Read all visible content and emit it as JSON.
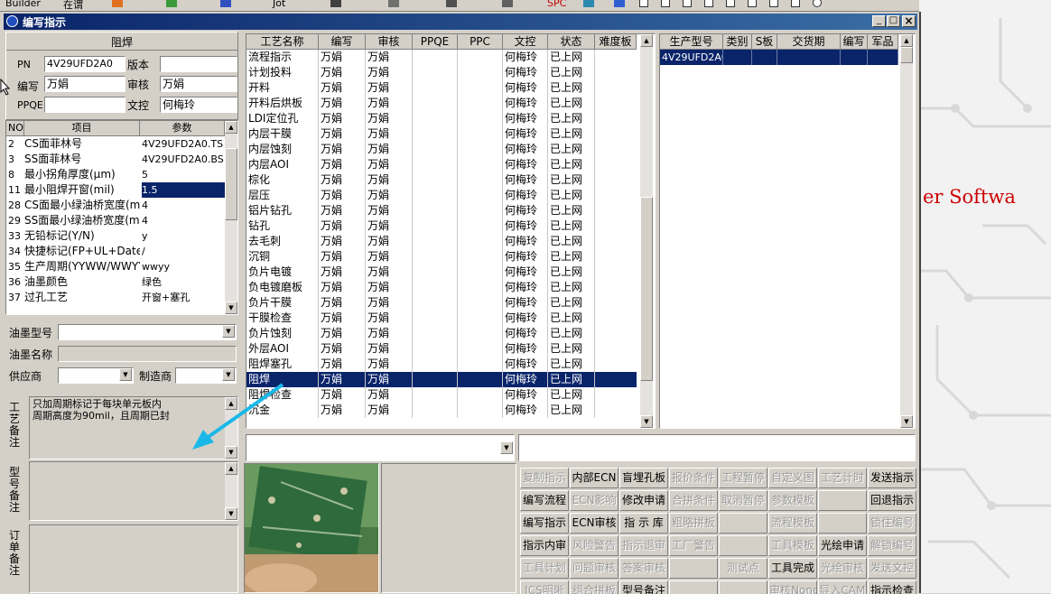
{
  "taskbar": {
    "app_label": "Builder",
    "item2": "在谓",
    "item3": "Jot",
    "item4": "SPC"
  },
  "background_text": "er Softwa",
  "window": {
    "title": "编写指示",
    "minimize": "_",
    "maximize": "□",
    "close": "×"
  },
  "header": {
    "section": "阻焊",
    "pn_label": "PN",
    "pn_value": "4V29UFD2A0",
    "version_label": "版本",
    "version_value": "",
    "writer_label": "编写",
    "writer_value": "万娟",
    "reviewer_label": "审核",
    "reviewer_value": "万娟",
    "ppqe_label": "PPQE",
    "ppqe_value": "",
    "doc_label": "文控",
    "doc_value": "何梅玲"
  },
  "params": {
    "col_no": "NO",
    "col_item": "项目",
    "col_param": "参数",
    "rows": [
      {
        "no": "2",
        "item": "CS面菲林号",
        "param": "4V29UFD2A0.TS"
      },
      {
        "no": "3",
        "item": "SS面菲林号",
        "param": "4V29UFD2A0.BS"
      },
      {
        "no": "8",
        "item": "最小拐角厚度(μm)",
        "param": "5"
      },
      {
        "no": "11",
        "item": "最小阻焊开窗(mil)",
        "param": "1.5"
      },
      {
        "no": "28",
        "item": "CS面最小绿油桥宽度(m",
        "param": "4"
      },
      {
        "no": "29",
        "item": "SS面最小绿油桥宽度(m",
        "param": "4"
      },
      {
        "no": "33",
        "item": "无铅标记(Y/N)",
        "param": "y"
      },
      {
        "no": "34",
        "item": "快捷标记(FP+UL+DateCo",
        "param": "/"
      },
      {
        "no": "35",
        "item": "生产周期(YYWW/WWYY)",
        "param": "wwyy"
      },
      {
        "no": "36",
        "item": "油墨颜色",
        "param": "绿色"
      },
      {
        "no": "37",
        "item": "过孔工艺",
        "param": "开窗+塞孔"
      }
    ],
    "selected_index": 3
  },
  "ink": {
    "type_label": "油墨型号",
    "type_value": "",
    "name_label": "油墨名称",
    "name_value": "",
    "supplier_label": "供应商",
    "supplier_value": "",
    "maker_label": "制造商",
    "maker_value": ""
  },
  "notes": {
    "process_label": "工艺备注",
    "process_text": "只加周期标记于每块单元板内\n周期高度为90mil，且周期已封",
    "model_label": "型号备注",
    "order_label": "订单备注"
  },
  "process_table": {
    "headers": [
      "工艺名称",
      "编写",
      "审核",
      "PPQE",
      "PPC",
      "文控",
      "状态",
      "难度板"
    ],
    "rows": [
      {
        "name": "流程指示",
        "writer": "万娟",
        "reviewer": "万娟",
        "ppqe": "",
        "ppc": "",
        "doc": "何梅玲",
        "status": "已上网",
        "diff": ""
      },
      {
        "name": "计划投料",
        "writer": "万娟",
        "reviewer": "万娟",
        "ppqe": "",
        "ppc": "",
        "doc": "何梅玲",
        "status": "已上网",
        "diff": ""
      },
      {
        "name": "开料",
        "writer": "万娟",
        "reviewer": "万娟",
        "ppqe": "",
        "ppc": "",
        "doc": "何梅玲",
        "status": "已上网",
        "diff": ""
      },
      {
        "name": "开料后烘板",
        "writer": "万娟",
        "reviewer": "万娟",
        "ppqe": "",
        "ppc": "",
        "doc": "何梅玲",
        "status": "已上网",
        "diff": ""
      },
      {
        "name": "LDI定位孔",
        "writer": "万娟",
        "reviewer": "万娟",
        "ppqe": "",
        "ppc": "",
        "doc": "何梅玲",
        "status": "已上网",
        "diff": ""
      },
      {
        "name": "内层干膜",
        "writer": "万娟",
        "reviewer": "万娟",
        "ppqe": "",
        "ppc": "",
        "doc": "何梅玲",
        "status": "已上网",
        "diff": ""
      },
      {
        "name": "内层蚀刻",
        "writer": "万娟",
        "reviewer": "万娟",
        "ppqe": "",
        "ppc": "",
        "doc": "何梅玲",
        "status": "已上网",
        "diff": ""
      },
      {
        "name": "内层AOI",
        "writer": "万娟",
        "reviewer": "万娟",
        "ppqe": "",
        "ppc": "",
        "doc": "何梅玲",
        "status": "已上网",
        "diff": ""
      },
      {
        "name": "棕化",
        "writer": "万娟",
        "reviewer": "万娟",
        "ppqe": "",
        "ppc": "",
        "doc": "何梅玲",
        "status": "已上网",
        "diff": ""
      },
      {
        "name": "层压",
        "writer": "万娟",
        "reviewer": "万娟",
        "ppqe": "",
        "ppc": "",
        "doc": "何梅玲",
        "status": "已上网",
        "diff": ""
      },
      {
        "name": "铝片钻孔",
        "writer": "万娟",
        "reviewer": "万娟",
        "ppqe": "",
        "ppc": "",
        "doc": "何梅玲",
        "status": "已上网",
        "diff": ""
      },
      {
        "name": "钻孔",
        "writer": "万娟",
        "reviewer": "万娟",
        "ppqe": "",
        "ppc": "",
        "doc": "何梅玲",
        "status": "已上网",
        "diff": ""
      },
      {
        "name": "去毛刺",
        "writer": "万娟",
        "reviewer": "万娟",
        "ppqe": "",
        "ppc": "",
        "doc": "何梅玲",
        "status": "已上网",
        "diff": ""
      },
      {
        "name": "沉铜",
        "writer": "万娟",
        "reviewer": "万娟",
        "ppqe": "",
        "ppc": "",
        "doc": "何梅玲",
        "status": "已上网",
        "diff": ""
      },
      {
        "name": "负片电镀",
        "writer": "万娟",
        "reviewer": "万娟",
        "ppqe": "",
        "ppc": "",
        "doc": "何梅玲",
        "status": "已上网",
        "diff": ""
      },
      {
        "name": "负电镀磨板",
        "writer": "万娟",
        "reviewer": "万娟",
        "ppqe": "",
        "ppc": "",
        "doc": "何梅玲",
        "status": "已上网",
        "diff": ""
      },
      {
        "name": "负片干膜",
        "writer": "万娟",
        "reviewer": "万娟",
        "ppqe": "",
        "ppc": "",
        "doc": "何梅玲",
        "status": "已上网",
        "diff": ""
      },
      {
        "name": "干膜检查",
        "writer": "万娟",
        "reviewer": "万娟",
        "ppqe": "",
        "ppc": "",
        "doc": "何梅玲",
        "status": "已上网",
        "diff": ""
      },
      {
        "name": "负片蚀刻",
        "writer": "万娟",
        "reviewer": "万娟",
        "ppqe": "",
        "ppc": "",
        "doc": "何梅玲",
        "status": "已上网",
        "diff": ""
      },
      {
        "name": "外层AOI",
        "writer": "万娟",
        "reviewer": "万娟",
        "ppqe": "",
        "ppc": "",
        "doc": "何梅玲",
        "status": "已上网",
        "diff": ""
      },
      {
        "name": "阻焊塞孔",
        "writer": "万娟",
        "reviewer": "万娟",
        "ppqe": "",
        "ppc": "",
        "doc": "何梅玲",
        "status": "已上网",
        "diff": ""
      },
      {
        "name": "阻焊",
        "writer": "万娟",
        "reviewer": "万娟",
        "ppqe": "",
        "ppc": "",
        "doc": "何梅玲",
        "status": "已上网",
        "diff": ""
      },
      {
        "name": "阻焊检查",
        "writer": "万娟",
        "reviewer": "万娟",
        "ppqe": "",
        "ppc": "",
        "doc": "何梅玲",
        "status": "已上网",
        "diff": ""
      },
      {
        "name": "沉金",
        "writer": "万娟",
        "reviewer": "万娟",
        "ppqe": "",
        "ppc": "",
        "doc": "何梅玲",
        "status": "已上网",
        "diff": ""
      }
    ],
    "selected_index": 21
  },
  "model_table": {
    "headers": [
      "生产型号",
      "类别",
      "S板",
      "交货期",
      "编写",
      "军品"
    ],
    "rows": [
      {
        "model": "4V29UFD2A0",
        "type": "",
        "s": "",
        "date": "",
        "writer": "",
        "mil": ""
      }
    ]
  },
  "buttons": [
    [
      "复制指示",
      "内部ECN",
      "盲埋孔板",
      "报价条件",
      "工程暂停",
      "自定义图",
      "工艺计时",
      "发送指示"
    ],
    [
      "编写流程",
      "ECN影响",
      "修改申请",
      "合拼条件",
      "取消暂停",
      "参数模板",
      "",
      "回退指示"
    ],
    [
      "编写指示",
      "ECN审核",
      "指 示 库",
      "粗略拼板",
      "",
      "流程模板",
      "",
      "锁住编号"
    ],
    [
      "指示内审",
      "风险警告",
      "指示退审",
      "工厂警告",
      "",
      "工具模板",
      "光绘申请",
      "解锁编号"
    ],
    [
      "工具计划",
      "问题审核",
      "答案审核",
      "",
      "测试点",
      "工具完成",
      "光绘审核",
      "发送文控"
    ],
    [
      "ICS明晰",
      "组合拼板",
      "型号备注",
      "",
      "",
      "审核None",
      "导入CAM",
      "指示检查"
    ]
  ],
  "buttons_enabled": [
    [
      false,
      true,
      true,
      false,
      false,
      false,
      false,
      true
    ],
    [
      true,
      false,
      true,
      false,
      false,
      false,
      false,
      true
    ],
    [
      true,
      true,
      true,
      false,
      false,
      false,
      false,
      false
    ],
    [
      true,
      false,
      false,
      false,
      false,
      false,
      true,
      false
    ],
    [
      false,
      false,
      false,
      false,
      false,
      true,
      false,
      false
    ],
    [
      false,
      false,
      true,
      false,
      false,
      false,
      false,
      true
    ]
  ],
  "colors": {
    "selection": "#0a246a",
    "arrow": "#1ab8e8",
    "title_bar": "#0a246a",
    "desktop_red": "#cc0000"
  }
}
